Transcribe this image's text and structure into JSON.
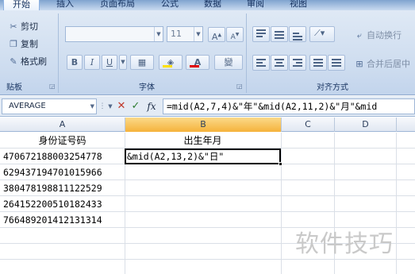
{
  "tabs": [
    "开始",
    "插入",
    "页面布局",
    "公式",
    "数据",
    "审阅",
    "视图"
  ],
  "clipboard": {
    "cut": "剪切",
    "copy": "复制",
    "format_painter": "格式刷",
    "group_label": "贴板"
  },
  "font": {
    "size": "11",
    "bold": "B",
    "italic": "I",
    "underline": "U",
    "group_label": "字体",
    "phonetic": "變"
  },
  "alignment": {
    "wrap_text": "自动换行",
    "merge_center": "合并后居中",
    "group_label": "对齐方式"
  },
  "formula_bar": {
    "name_box": "AVERAGE",
    "cancel": "✕",
    "enter": "✓",
    "fx": "fx",
    "formula": "=mid(A2,7,4)&\"年\"&mid(A2,11,2)&\"月\"&mid"
  },
  "columns": [
    "A",
    "B",
    "C",
    "D"
  ],
  "rows": [
    {
      "a": "身份证号码",
      "b": "出生年月"
    },
    {
      "a": "470672188003254778",
      "b": "&mid(A2,13,2)&\"日\""
    },
    {
      "a": "629437194701015966",
      "b": ""
    },
    {
      "a": "380478198811122529",
      "b": ""
    },
    {
      "a": "264152200510182433",
      "b": ""
    },
    {
      "a": "766489201412131314",
      "b": ""
    }
  ],
  "watermark": "软件技巧",
  "colors": {
    "selected_column_header": "#f5b33b",
    "ribbon_background": "#cddcef",
    "active_cell_border": "#000000"
  }
}
